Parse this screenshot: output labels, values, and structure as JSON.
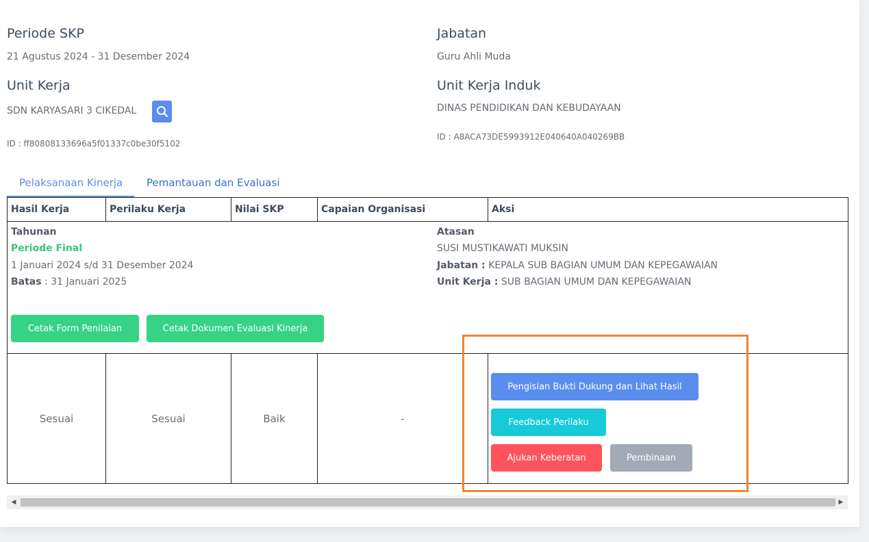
{
  "info": {
    "periode_label": "Periode SKP",
    "periode_value": "21 Agustus 2024 - 31 Desember 2024",
    "jabatan_label": "Jabatan",
    "jabatan_value": "Guru Ahli Muda",
    "unit_kerja_label": "Unit Kerja",
    "unit_kerja_value": "SDN KARYASARI 3 CIKEDAL",
    "unit_kerja_id": "ID : ff80808133696a5f01337c0be30f5102",
    "unit_induk_label": "Unit Kerja Induk",
    "unit_induk_value": "DINAS PENDIDIKAN DAN KEBUDAYAAN",
    "unit_induk_id": "ID : A8ACA73DE5993912E040640A040269BB"
  },
  "tabs": [
    {
      "label": "Pelaksanaan Kinerja",
      "active": true
    },
    {
      "label": "Pemantauan dan Evaluasi",
      "active": false
    }
  ],
  "table": {
    "headers": [
      "Hasil Kerja",
      "Perilaku Kerja",
      "Nilai SKP",
      "Capaian Organisasi",
      "Aksi"
    ],
    "periode": {
      "type": "Tahunan",
      "status": "Periode Final",
      "range": "1 Januari 2024 s/d 31 Desember 2024",
      "batas_label": "Batas",
      "batas_value": ": 31 Januari 2025"
    },
    "atasan": {
      "label": "Atasan",
      "name": "SUSI MUSTIKAWATI MUKSIN",
      "jabatan_label": "Jabatan :",
      "jabatan_value": "KEPALA SUB BAGIAN UMUM DAN KEPEGAWAIAN",
      "unit_label": "Unit Kerja :",
      "unit_value": "SUB BAGIAN UMUM DAN KEPEGAWAIAN"
    },
    "print_buttons": {
      "form": "Cetak Form Penilaian",
      "dokumen": "Cetak Dokumen Evaluasi Kinerja"
    },
    "row": {
      "hasil_kerja": "Sesuai",
      "perilaku_kerja": "Sesuai",
      "nilai_skp": "Baik",
      "capaian_organisasi": "-"
    },
    "actions": {
      "bukti": "Pengisian Bukti Dukung dan Lihat Hasil",
      "feedback": "Feedback Perilaku",
      "keberatan": "Ajukan Keberatan",
      "pembinaan": "Pembinaan"
    }
  },
  "colors": {
    "primary": "#5b8def",
    "success": "#36d387",
    "info": "#16cad8",
    "danger": "#ff525d",
    "secondary": "#a2aab5",
    "highlight": "#f4842c"
  }
}
